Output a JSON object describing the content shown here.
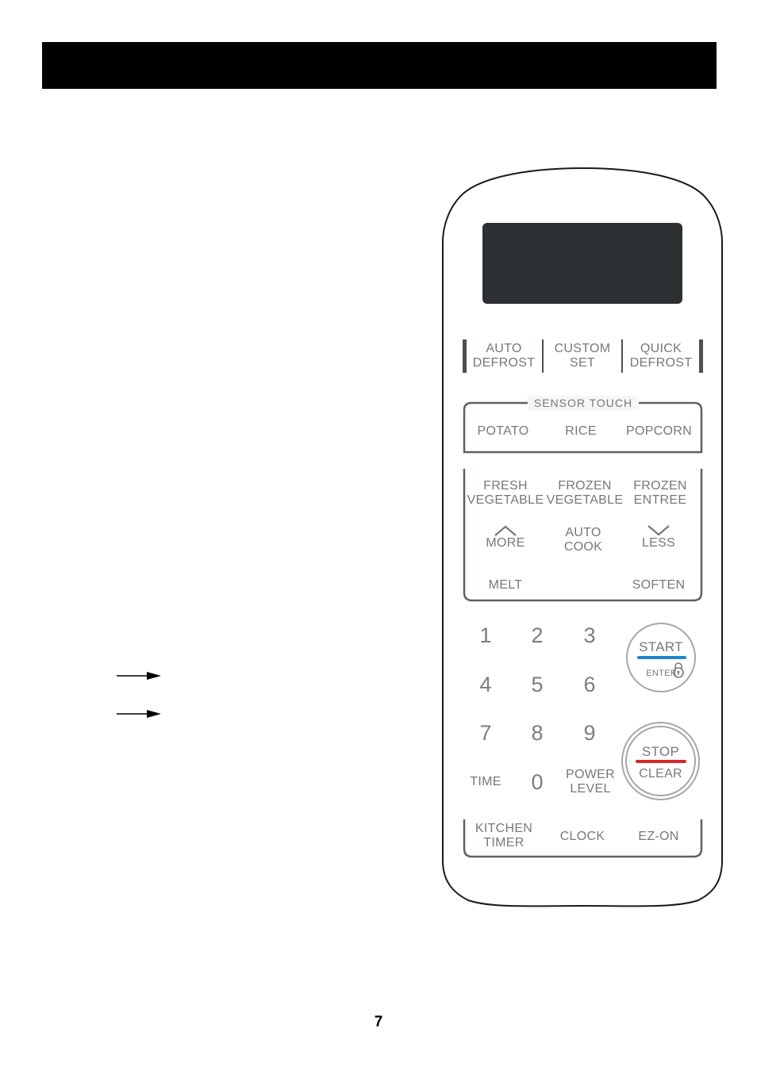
{
  "page": {
    "header_title": "",
    "page_number": "7"
  },
  "panel": {
    "top_row": [
      {
        "line1": "AUTO",
        "line2": "DEFROST"
      },
      {
        "line1": "CUSTOM",
        "line2": "SET"
      },
      {
        "line1": "QUICK",
        "line2": "DEFROST"
      }
    ],
    "sensor_touch": {
      "legend": "SENSOR TOUCH",
      "buttons": [
        "POTATO",
        "RICE",
        "POPCORN"
      ]
    },
    "auto_cook_group": {
      "row1": [
        {
          "line1": "FRESH",
          "line2": "VEGETABLE"
        },
        {
          "line1": "FROZEN",
          "line2": "VEGETABLE"
        },
        {
          "line1": "FROZEN",
          "line2": "ENTREE"
        }
      ],
      "more": "MORE",
      "more_icon": "chevron-up-icon",
      "auto_cook": {
        "line1": "AUTO",
        "line2": "COOK"
      },
      "less": "LESS",
      "less_icon": "chevron-down-icon",
      "melt": "MELT",
      "soften": "SOFTEN"
    },
    "keypad": {
      "digits": [
        "1",
        "2",
        "3",
        "4",
        "5",
        "6",
        "7",
        "8",
        "9",
        "0"
      ],
      "time": "TIME",
      "power_level": {
        "line1": "POWER",
        "line2": "LEVEL"
      }
    },
    "start_button": {
      "label": "START",
      "sublabel": "ENTER",
      "icon": "lock-icon",
      "accent_color": "#1f87c8"
    },
    "stop_button": {
      "label": "STOP",
      "sublabel": "CLEAR",
      "accent_color": "#d8282a"
    },
    "bottom_row": [
      {
        "line1": "KITCHEN",
        "line2": "TIMER"
      },
      {
        "line1": "CLOCK",
        "line2": ""
      },
      {
        "line1": "EZ-ON",
        "line2": ""
      }
    ]
  }
}
